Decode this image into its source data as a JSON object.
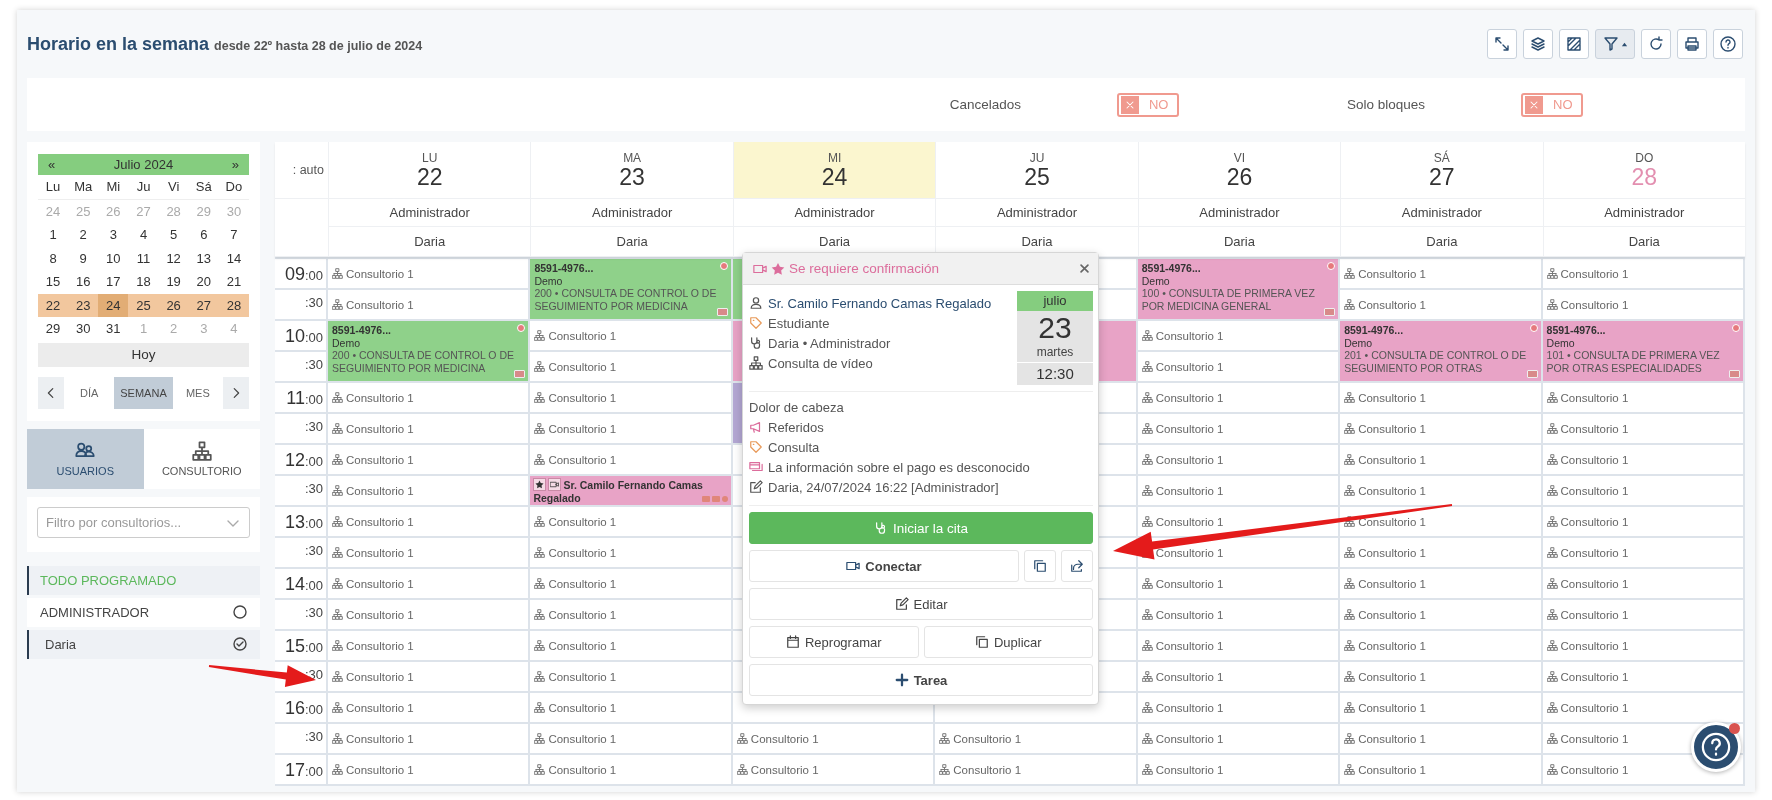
{
  "header": {
    "title": "Horario en la semana",
    "subtitle": "desde 22º hasta 28 de julio de 2024"
  },
  "toolbar": [
    {
      "kind": "expand",
      "active": false
    },
    {
      "kind": "layers",
      "active": false
    },
    {
      "kind": "hatch",
      "active": false
    },
    {
      "kind": "filter",
      "active": true
    },
    {
      "kind": "refresh",
      "active": false
    },
    {
      "kind": "print",
      "active": false
    },
    {
      "kind": "help",
      "active": false
    }
  ],
  "filters": [
    {
      "label": "Cancelados",
      "value": "NO",
      "on": false
    },
    {
      "label": "Solo bloques",
      "value": "NO",
      "on": false
    }
  ],
  "mini_calendar": {
    "prev": "«",
    "month": "Julio 2024",
    "next": "»",
    "weekdays": [
      "Lu",
      "Ma",
      "Mi",
      "Ju",
      "Vi",
      "Sá",
      "Do"
    ],
    "weeks": [
      {
        "selected": false,
        "days": [
          {
            "d": "24",
            "muted": true,
            "today": false
          },
          {
            "d": "25",
            "muted": true,
            "today": false
          },
          {
            "d": "26",
            "muted": true,
            "today": false
          },
          {
            "d": "27",
            "muted": true,
            "today": false
          },
          {
            "d": "28",
            "muted": true,
            "today": false
          },
          {
            "d": "29",
            "muted": true,
            "today": false
          },
          {
            "d": "30",
            "muted": true,
            "today": false
          }
        ]
      },
      {
        "selected": false,
        "days": [
          {
            "d": "1",
            "muted": false,
            "today": false
          },
          {
            "d": "2",
            "muted": false,
            "today": false
          },
          {
            "d": "3",
            "muted": false,
            "today": false
          },
          {
            "d": "4",
            "muted": false,
            "today": false
          },
          {
            "d": "5",
            "muted": false,
            "today": false
          },
          {
            "d": "6",
            "muted": false,
            "today": false
          },
          {
            "d": "7",
            "muted": false,
            "today": false
          }
        ]
      },
      {
        "selected": false,
        "days": [
          {
            "d": "8",
            "muted": false,
            "today": false
          },
          {
            "d": "9",
            "muted": false,
            "today": false
          },
          {
            "d": "10",
            "muted": false,
            "today": false
          },
          {
            "d": "11",
            "muted": false,
            "today": false
          },
          {
            "d": "12",
            "muted": false,
            "today": false
          },
          {
            "d": "13",
            "muted": false,
            "today": false
          },
          {
            "d": "14",
            "muted": false,
            "today": false
          }
        ]
      },
      {
        "selected": false,
        "days": [
          {
            "d": "15",
            "muted": false,
            "today": false
          },
          {
            "d": "16",
            "muted": false,
            "today": false
          },
          {
            "d": "17",
            "muted": false,
            "today": false
          },
          {
            "d": "18",
            "muted": false,
            "today": false
          },
          {
            "d": "19",
            "muted": false,
            "today": false
          },
          {
            "d": "20",
            "muted": false,
            "today": false
          },
          {
            "d": "21",
            "muted": false,
            "today": false
          }
        ]
      },
      {
        "selected": true,
        "days": [
          {
            "d": "22",
            "muted": false,
            "today": false
          },
          {
            "d": "23",
            "muted": false,
            "today": false
          },
          {
            "d": "24",
            "muted": false,
            "today": true
          },
          {
            "d": "25",
            "muted": false,
            "today": false
          },
          {
            "d": "26",
            "muted": false,
            "today": false
          },
          {
            "d": "27",
            "muted": false,
            "today": false
          },
          {
            "d": "28",
            "muted": false,
            "today": false
          }
        ]
      },
      {
        "selected": false,
        "days": [
          {
            "d": "29",
            "muted": false,
            "today": false
          },
          {
            "d": "30",
            "muted": false,
            "today": false
          },
          {
            "d": "31",
            "muted": false,
            "today": false
          },
          {
            "d": "1",
            "muted": true,
            "today": false
          },
          {
            "d": "2",
            "muted": true,
            "today": false
          },
          {
            "d": "3",
            "muted": true,
            "today": false
          },
          {
            "d": "4",
            "muted": true,
            "today": false
          }
        ]
      }
    ],
    "today_button": "Hoy"
  },
  "views": [
    {
      "label": "DÍA",
      "selected": false
    },
    {
      "label": "SEMANA",
      "selected": true
    },
    {
      "label": "MES",
      "selected": false
    }
  ],
  "tabs": [
    {
      "label": "USUARIOS",
      "kind": "users",
      "selected": true
    },
    {
      "label": "CONSULTORIO",
      "kind": "sitemap",
      "selected": false
    }
  ],
  "filter_select": {
    "placeholder": "Filtro por consultorios..."
  },
  "user_list": [
    {
      "label": "TODO PROGRAMADO",
      "kind": "all",
      "selected": true
    },
    {
      "label": "ADMINISTRADOR",
      "kind": "user",
      "selected": false,
      "checked": false
    },
    {
      "label": "Daria",
      "kind": "user",
      "selected": true,
      "checked": true
    }
  ],
  "auto_label": ": auto",
  "days": [
    {
      "abbr": "LU",
      "num": "22",
      "today": false,
      "sunday": false,
      "user": "Administrador",
      "person": "Daria"
    },
    {
      "abbr": "MA",
      "num": "23",
      "today": false,
      "sunday": false,
      "user": "Administrador",
      "person": "Daria"
    },
    {
      "abbr": "MI",
      "num": "24",
      "today": true,
      "sunday": false,
      "user": "Administrador",
      "person": "Daria"
    },
    {
      "abbr": "JU",
      "num": "25",
      "today": false,
      "sunday": false,
      "user": "Administrador",
      "person": "Daria"
    },
    {
      "abbr": "VI",
      "num": "26",
      "today": false,
      "sunday": false,
      "user": "Administrador",
      "person": "Daria"
    },
    {
      "abbr": "SÁ",
      "num": "27",
      "today": false,
      "sunday": false,
      "user": "Administrador",
      "person": "Daria"
    },
    {
      "abbr": "DO",
      "num": "28",
      "today": false,
      "sunday": true,
      "user": "Administrador",
      "person": "Daria"
    }
  ],
  "times": [
    {
      "hour": "09",
      "minute": ":00"
    },
    {
      "minute": ":30"
    },
    {
      "hour": "10",
      "minute": ":00"
    },
    {
      "minute": ":30"
    },
    {
      "hour": "11",
      "minute": ":00"
    },
    {
      "minute": ":30"
    },
    {
      "hour": "12",
      "minute": ":00"
    },
    {
      "minute": ":30"
    },
    {
      "hour": "13",
      "minute": ":00"
    },
    {
      "minute": ":30"
    },
    {
      "hour": "14",
      "minute": ":00"
    },
    {
      "minute": ":30"
    },
    {
      "hour": "15",
      "minute": ":00"
    },
    {
      "minute": ":30"
    },
    {
      "hour": "16",
      "minute": ":00"
    },
    {
      "minute": ":30"
    },
    {
      "hour": "17",
      "minute": ":00"
    }
  ],
  "columns": [
    [
      {
        "kind": "slot",
        "label": "Consultorio 1"
      },
      {
        "kind": "slot",
        "label": "Consultorio 1"
      },
      {
        "kind": "event",
        "color": "#8fd18a",
        "code": "8591-4976...",
        "name": "Demo",
        "service": "200 • CONSULTA DE CONTROL O DE SEGUIMIENTO POR MEDICINA"
      },
      {
        "kind": "slot",
        "label": "Consultorio 1"
      },
      {
        "kind": "slot",
        "label": "Consultorio 1"
      },
      {
        "kind": "slot",
        "label": "Consultorio 1"
      },
      {
        "kind": "slot",
        "label": "Consultorio 1"
      },
      {
        "kind": "slot",
        "label": "Consultorio 1"
      },
      {
        "kind": "slot",
        "label": "Consultorio 1"
      },
      {
        "kind": "slot",
        "label": "Consultorio 1"
      },
      {
        "kind": "slot",
        "label": "Consultorio 1"
      },
      {
        "kind": "slot",
        "label": "Consultorio 1"
      },
      {
        "kind": "slot",
        "label": "Consultorio 1"
      },
      {
        "kind": "slot",
        "label": "Consultorio 1"
      },
      {
        "kind": "slot",
        "label": "Consultorio 1"
      },
      {
        "kind": "slot",
        "label": "Consultorio 1"
      }
    ],
    [
      {
        "kind": "event",
        "color": "#8fd18a",
        "code": "8591-4976...",
        "name": "Demo",
        "service": "200 • CONSULTA DE CONTROL O DE SEGUIMIENTO POR MEDICINA"
      },
      {
        "kind": "slot",
        "label": "Consultorio 1"
      },
      {
        "kind": "slot",
        "label": "Consultorio 1"
      },
      {
        "kind": "slot",
        "label": "Consultorio 1"
      },
      {
        "kind": "slot",
        "label": "Consultorio 1"
      },
      {
        "kind": "slot",
        "label": "Consultorio 1"
      },
      {
        "kind": "appointment",
        "color": "#e8a3c6",
        "title": "Sr. Camilo Fernando Camas Regalado"
      },
      {
        "kind": "slot",
        "label": "Consultorio 1"
      },
      {
        "kind": "slot",
        "label": "Consultorio 1"
      },
      {
        "kind": "slot",
        "label": "Consultorio 1"
      },
      {
        "kind": "slot",
        "label": "Consultorio 1"
      },
      {
        "kind": "slot",
        "label": "Consultorio 1"
      },
      {
        "kind": "slot",
        "label": "Consultorio 1"
      },
      {
        "kind": "slot",
        "label": "Consultorio 1"
      },
      {
        "kind": "slot",
        "label": "Consultorio 1"
      },
      {
        "kind": "slot",
        "label": "Consultorio 1"
      }
    ],
    [
      {
        "kind": "block",
        "color": "#8fd18a"
      },
      {
        "kind": "block",
        "color": "#e8a3c6"
      },
      {
        "kind": "block",
        "color": "#b3a7d3"
      },
      {
        "kind": "empty"
      },
      {
        "kind": "empty"
      },
      {
        "kind": "empty"
      },
      {
        "kind": "empty"
      },
      {
        "kind": "empty"
      },
      {
        "kind": "empty"
      },
      {
        "kind": "empty"
      },
      {
        "kind": "empty"
      },
      {
        "kind": "empty"
      },
      {
        "kind": "slot",
        "label": "Consultorio 1"
      },
      {
        "kind": "slot",
        "label": "Consultorio 1"
      }
    ],
    [
      {
        "kind": "empty"
      },
      {
        "kind": "empty"
      },
      {
        "kind": "block",
        "color": "#e8a3c6"
      },
      {
        "kind": "empty"
      },
      {
        "kind": "empty"
      },
      {
        "kind": "empty"
      },
      {
        "kind": "empty"
      },
      {
        "kind": "empty"
      },
      {
        "kind": "empty"
      },
      {
        "kind": "empty"
      },
      {
        "kind": "empty"
      },
      {
        "kind": "empty"
      },
      {
        "kind": "empty"
      },
      {
        "kind": "empty"
      },
      {
        "kind": "slot",
        "label": "Consultorio 1"
      },
      {
        "kind": "slot",
        "label": "Consultorio 1"
      }
    ],
    [
      {
        "kind": "event",
        "color": "#e8a3c6",
        "code": "8591-4976...",
        "name": "Demo",
        "service": "100 • CONSULTA DE PRIMERA VEZ POR MEDICINA GENERAL"
      },
      {
        "kind": "slot",
        "label": "Consultorio 1"
      },
      {
        "kind": "slot",
        "label": "Consultorio 1"
      },
      {
        "kind": "slot",
        "label": "Consultorio 1"
      },
      {
        "kind": "slot",
        "label": "Consultorio 1"
      },
      {
        "kind": "slot",
        "label": "Consultorio 1"
      },
      {
        "kind": "slot",
        "label": "Consultorio 1"
      },
      {
        "kind": "slot",
        "label": "Consultorio 1"
      },
      {
        "kind": "slot",
        "label": "Consultorio 1"
      },
      {
        "kind": "slot",
        "label": "Consultorio 1"
      },
      {
        "kind": "slot",
        "label": "Consultorio 1"
      },
      {
        "kind": "slot",
        "label": "Consultorio 1"
      },
      {
        "kind": "slot",
        "label": "Consultorio 1"
      },
      {
        "kind": "slot",
        "label": "Consultorio 1"
      },
      {
        "kind": "slot",
        "label": "Consultorio 1"
      },
      {
        "kind": "slot",
        "label": "Consultorio 1"
      }
    ],
    [
      {
        "kind": "slot",
        "label": "Consultorio 1"
      },
      {
        "kind": "slot",
        "label": "Consultorio 1"
      },
      {
        "kind": "event",
        "color": "#e8a3c6",
        "code": "8591-4976...",
        "name": "Demo",
        "service": "201 • CONSULTA DE CONTROL O DE SEGUIMIENTO POR OTRAS"
      },
      {
        "kind": "slot",
        "label": "Consultorio 1"
      },
      {
        "kind": "slot",
        "label": "Consultorio 1"
      },
      {
        "kind": "slot",
        "label": "Consultorio 1"
      },
      {
        "kind": "slot",
        "label": "Consultorio 1"
      },
      {
        "kind": "slot",
        "label": "Consultorio 1"
      },
      {
        "kind": "slot",
        "label": "Consultorio 1"
      },
      {
        "kind": "slot",
        "label": "Consultorio 1"
      },
      {
        "kind": "slot",
        "label": "Consultorio 1"
      },
      {
        "kind": "slot",
        "label": "Consultorio 1"
      },
      {
        "kind": "slot",
        "label": "Consultorio 1"
      },
      {
        "kind": "slot",
        "label": "Consultorio 1"
      },
      {
        "kind": "slot",
        "label": "Consultorio 1"
      },
      {
        "kind": "slot",
        "label": "Consultorio 1"
      }
    ],
    [
      {
        "kind": "slot",
        "label": "Consultorio 1"
      },
      {
        "kind": "slot",
        "label": "Consultorio 1"
      },
      {
        "kind": "event",
        "color": "#e8a3c6",
        "code": "8591-4976...",
        "name": "Demo",
        "service": "101 • CONSULTA DE PRIMERA VEZ POR OTRAS ESPECIALIDADES"
      },
      {
        "kind": "slot",
        "label": "Consultorio 1"
      },
      {
        "kind": "slot",
        "label": "Consultorio 1"
      },
      {
        "kind": "slot",
        "label": "Consultorio 1"
      },
      {
        "kind": "slot",
        "label": "Consultorio 1"
      },
      {
        "kind": "slot",
        "label": "Consultorio 1"
      },
      {
        "kind": "slot",
        "label": "Consultorio 1"
      },
      {
        "kind": "slot",
        "label": "Consultorio 1"
      },
      {
        "kind": "slot",
        "label": "Consultorio 1"
      },
      {
        "kind": "slot",
        "label": "Consultorio 1"
      },
      {
        "kind": "slot",
        "label": "Consultorio 1"
      },
      {
        "kind": "slot",
        "label": "Consultorio 1"
      },
      {
        "kind": "slot",
        "label": "Consultorio 1"
      },
      {
        "kind": "slot",
        "label": "Consultorio 1"
      }
    ]
  ],
  "popup": {
    "header": "Se requiere confirmación",
    "details": [
      {
        "kind": "person",
        "text": "Sr. Camilo Fernando Camas Regalado"
      },
      {
        "kind": "tag",
        "text": "Estudiante"
      },
      {
        "kind": "doctor",
        "text": "Daria • Administrador"
      },
      {
        "kind": "sitemap",
        "text": "Consulta de vídeo"
      }
    ],
    "date": {
      "month": "julio",
      "day": "23",
      "weekday": "martes",
      "time": "12:30"
    },
    "notes": [
      {
        "kind": "plain",
        "text": "Dolor de cabeza"
      },
      {
        "kind": "megaphone",
        "text": "Referidos"
      },
      {
        "kind": "tag",
        "text": "Consulta"
      },
      {
        "kind": "payment",
        "text": "La información sobre el pago es desconocido"
      },
      {
        "kind": "edit",
        "text": "Daria, 24/07/2024 16:22 [Administrador]"
      }
    ],
    "actions": {
      "start": "Iniciar la cita",
      "connect": "Conectar",
      "edit": "Editar",
      "reschedule": "Reprogramar",
      "duplicate": "Duplicar",
      "task": "Tarea"
    }
  }
}
